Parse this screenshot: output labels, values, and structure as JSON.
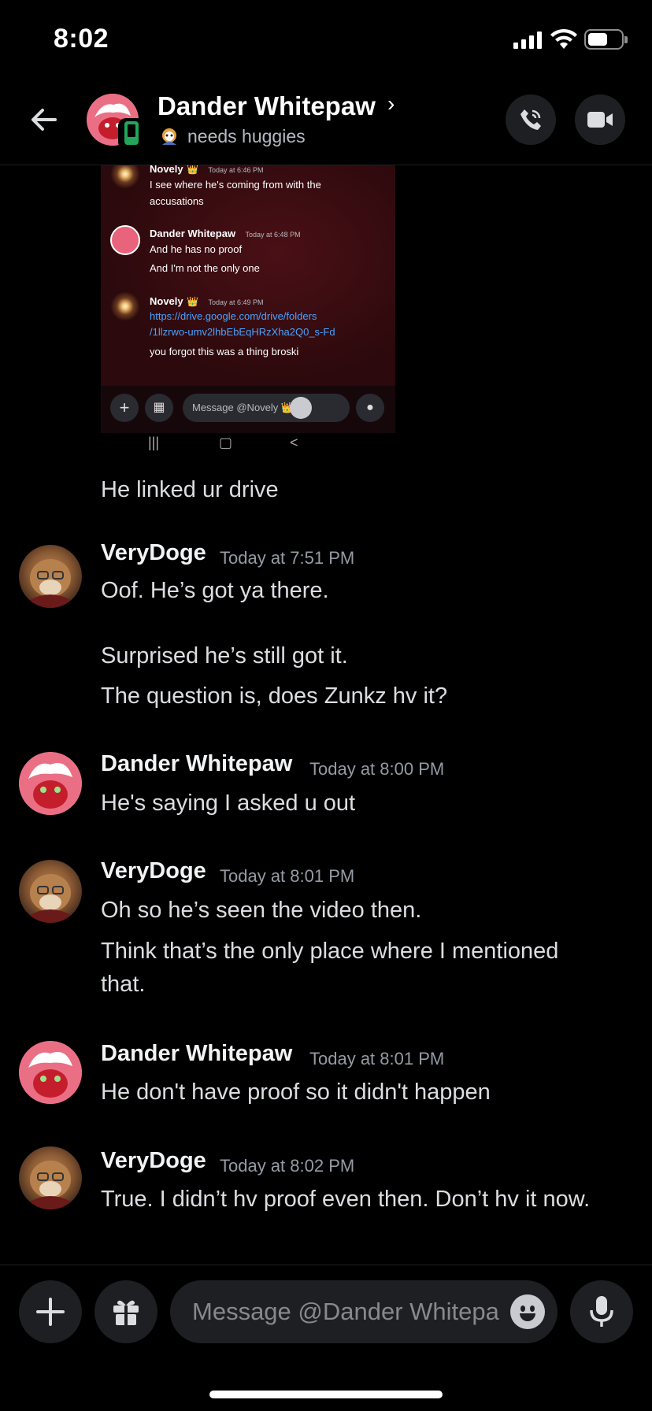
{
  "status_bar": {
    "time": "8:02"
  },
  "header": {
    "name": "Dander Whitepaw",
    "chevron": "›",
    "status": "needs huggies",
    "icons": [
      "back-arrow-icon",
      "phone-call-icon",
      "video-camera-icon",
      "mobile-status-icon"
    ]
  },
  "attachment": {
    "messages": [
      {
        "author": "Novely",
        "crown": "👑",
        "time": "Today at 6:46 PM",
        "lines": [
          "I see where he's coming from with the",
          "accusations"
        ]
      },
      {
        "author": "Dander Whitepaw",
        "crown": "",
        "time": "Today at 6:48 PM",
        "lines": [
          "And he has no proof",
          "And I'm not the only one"
        ]
      },
      {
        "author": "Novely",
        "crown": "👑",
        "time": "Today at 6:49 PM",
        "link": [
          "https://drive.google.com/drive/folders",
          "/1llzrwo-umv2lhbEbEqHRzXha2Q0_s-Fd"
        ],
        "lines": [
          "you forgot this was a thing broski"
        ]
      }
    ],
    "input_placeholder": "Message @Novely 👑",
    "nav": [
      "|||",
      "▢",
      "<"
    ]
  },
  "messages": [
    {
      "author": "",
      "time": "",
      "lines": [
        "He linked ur drive"
      ]
    },
    {
      "author": "VeryDoge",
      "time": "Today at 7:51 PM",
      "lines": [
        "Oof. He’s got ya there.",
        "Surprised he’s still got it.",
        "The question is, does Zunkz hv it?"
      ]
    },
    {
      "author": "Dander Whitepaw",
      "time": "Today at 8:00 PM",
      "lines": [
        "He's saying I asked u out"
      ]
    },
    {
      "author": "VeryDoge",
      "time": "Today at 8:01 PM",
      "lines": [
        "Oh so he’s seen the video then.",
        "Think that’s the only place where I mentioned",
        "that."
      ]
    },
    {
      "author": "Dander Whitepaw",
      "time": "Today at 8:01 PM",
      "lines": [
        "He don't have proof so it didn't happen"
      ]
    },
    {
      "author": "VeryDoge",
      "time": "Today at 8:02 PM",
      "lines": [
        "True. I didn’t hv proof even then. Don’t hv it now."
      ]
    }
  ],
  "composer": {
    "placeholder": "Message @Dander Whitepaw",
    "icons": [
      "plus-icon",
      "gift-icon",
      "emoji-icon",
      "microphone-icon"
    ]
  },
  "colors": {
    "background": "#000000",
    "link": "#4aa3ff",
    "online_mobile": "#23a55a",
    "muted_text": "#949ba4"
  }
}
